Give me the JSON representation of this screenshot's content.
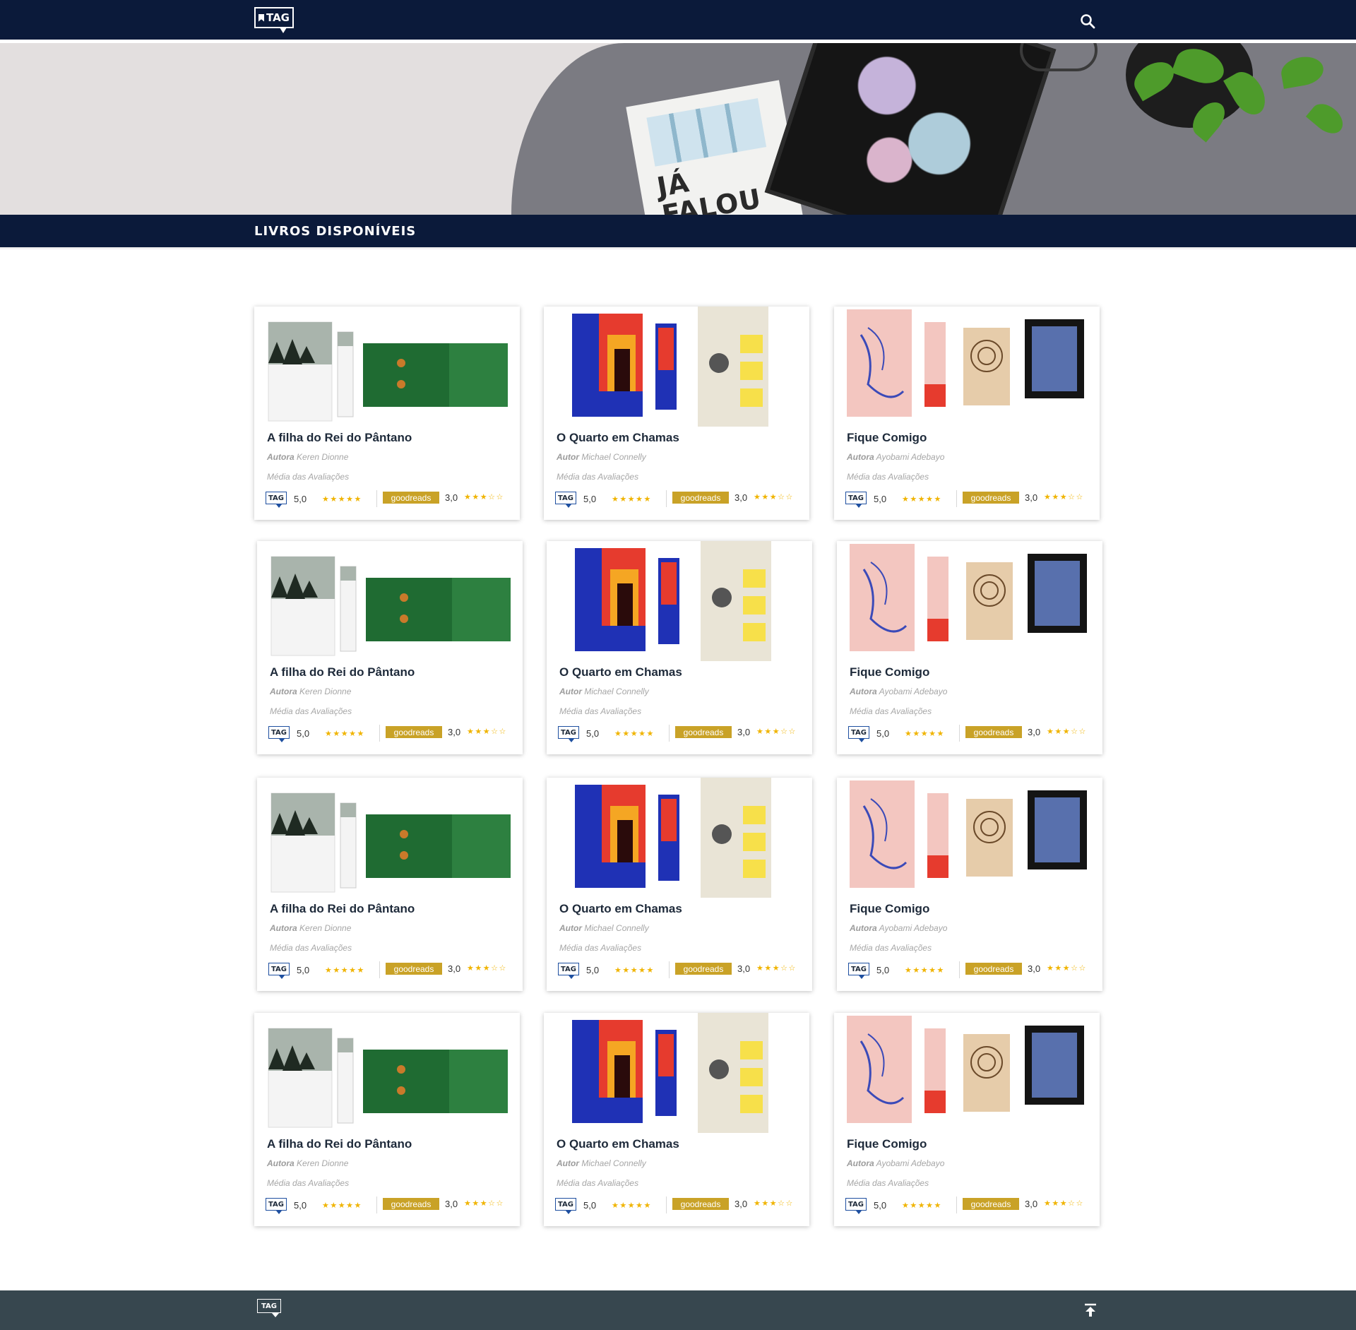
{
  "header": {
    "logo_text": "TAG",
    "search_icon": "search-icon"
  },
  "section": {
    "title": "LIVROS DISPONÍVEIS"
  },
  "hero": {
    "image_text": "JÁ FALOU QUE AMA"
  },
  "card_labels": {
    "avg": "Média das Avaliações",
    "tag_logo": "TAG",
    "goodreads": "goodreads"
  },
  "books": [
    {
      "title": "A filha do Rei do Pântano",
      "author_label": "Autora",
      "author": "Keren Dionne",
      "tag_score": "5,0",
      "tag_stars": "★★★★★",
      "gr_score": "3,0",
      "gr_stars": "★★★☆☆"
    },
    {
      "title": "O Quarto em Chamas",
      "author_label": "Autor",
      "author": "Michael Connelly",
      "tag_score": "5,0",
      "tag_stars": "★★★★★",
      "gr_score": "3,0",
      "gr_stars": "★★★☆☆"
    },
    {
      "title": "Fique Comigo",
      "author_label": "Autora",
      "author": "Ayobami Adebayo",
      "tag_score": "5,0",
      "tag_stars": "★★★★★",
      "gr_score": "3,0",
      "gr_stars": "★★★☆☆"
    }
  ],
  "footer": {
    "logo_text": "TAG",
    "to_top_icon": "arrow-up-to-top-icon"
  },
  "colors": {
    "navy": "#0b1a3a",
    "footer": "#37474f",
    "star": "#f0b400",
    "goodreads": "#c9a227"
  }
}
